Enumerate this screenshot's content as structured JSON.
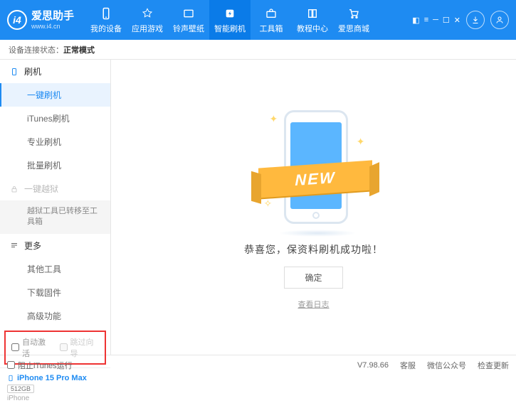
{
  "header": {
    "app_title": "爱思助手",
    "app_url": "www.i4.cn",
    "logo_letter": "i4",
    "nav": [
      {
        "label": "我的设备"
      },
      {
        "label": "应用游戏"
      },
      {
        "label": "铃声壁纸"
      },
      {
        "label": "智能刷机"
      },
      {
        "label": "工具箱"
      },
      {
        "label": "教程中心"
      },
      {
        "label": "爱思商城"
      }
    ]
  },
  "status": {
    "label": "设备连接状态：",
    "value": "正常模式"
  },
  "sidebar": {
    "flash": {
      "title": "刷机",
      "items": [
        "一键刷机",
        "iTunes刷机",
        "专业刷机",
        "批量刷机"
      ]
    },
    "jailbreak": {
      "title": "一键越狱",
      "note": "越狱工具已转移至工具箱"
    },
    "more": {
      "title": "更多",
      "items": [
        "其他工具",
        "下载固件",
        "高级功能"
      ]
    },
    "checks": {
      "auto_activate": "自动激活",
      "skip_guide": "跳过向导"
    },
    "device": {
      "name": "iPhone 15 Pro Max",
      "capacity": "512GB",
      "type": "iPhone"
    }
  },
  "main": {
    "ribbon": "NEW",
    "message": "恭喜您，保资料刷机成功啦！",
    "ok": "确定",
    "view_log": "查看日志"
  },
  "footer": {
    "block_itunes": "阻止iTunes运行",
    "version": "V7.98.66",
    "links": [
      "客服",
      "微信公众号",
      "检查更新"
    ]
  }
}
